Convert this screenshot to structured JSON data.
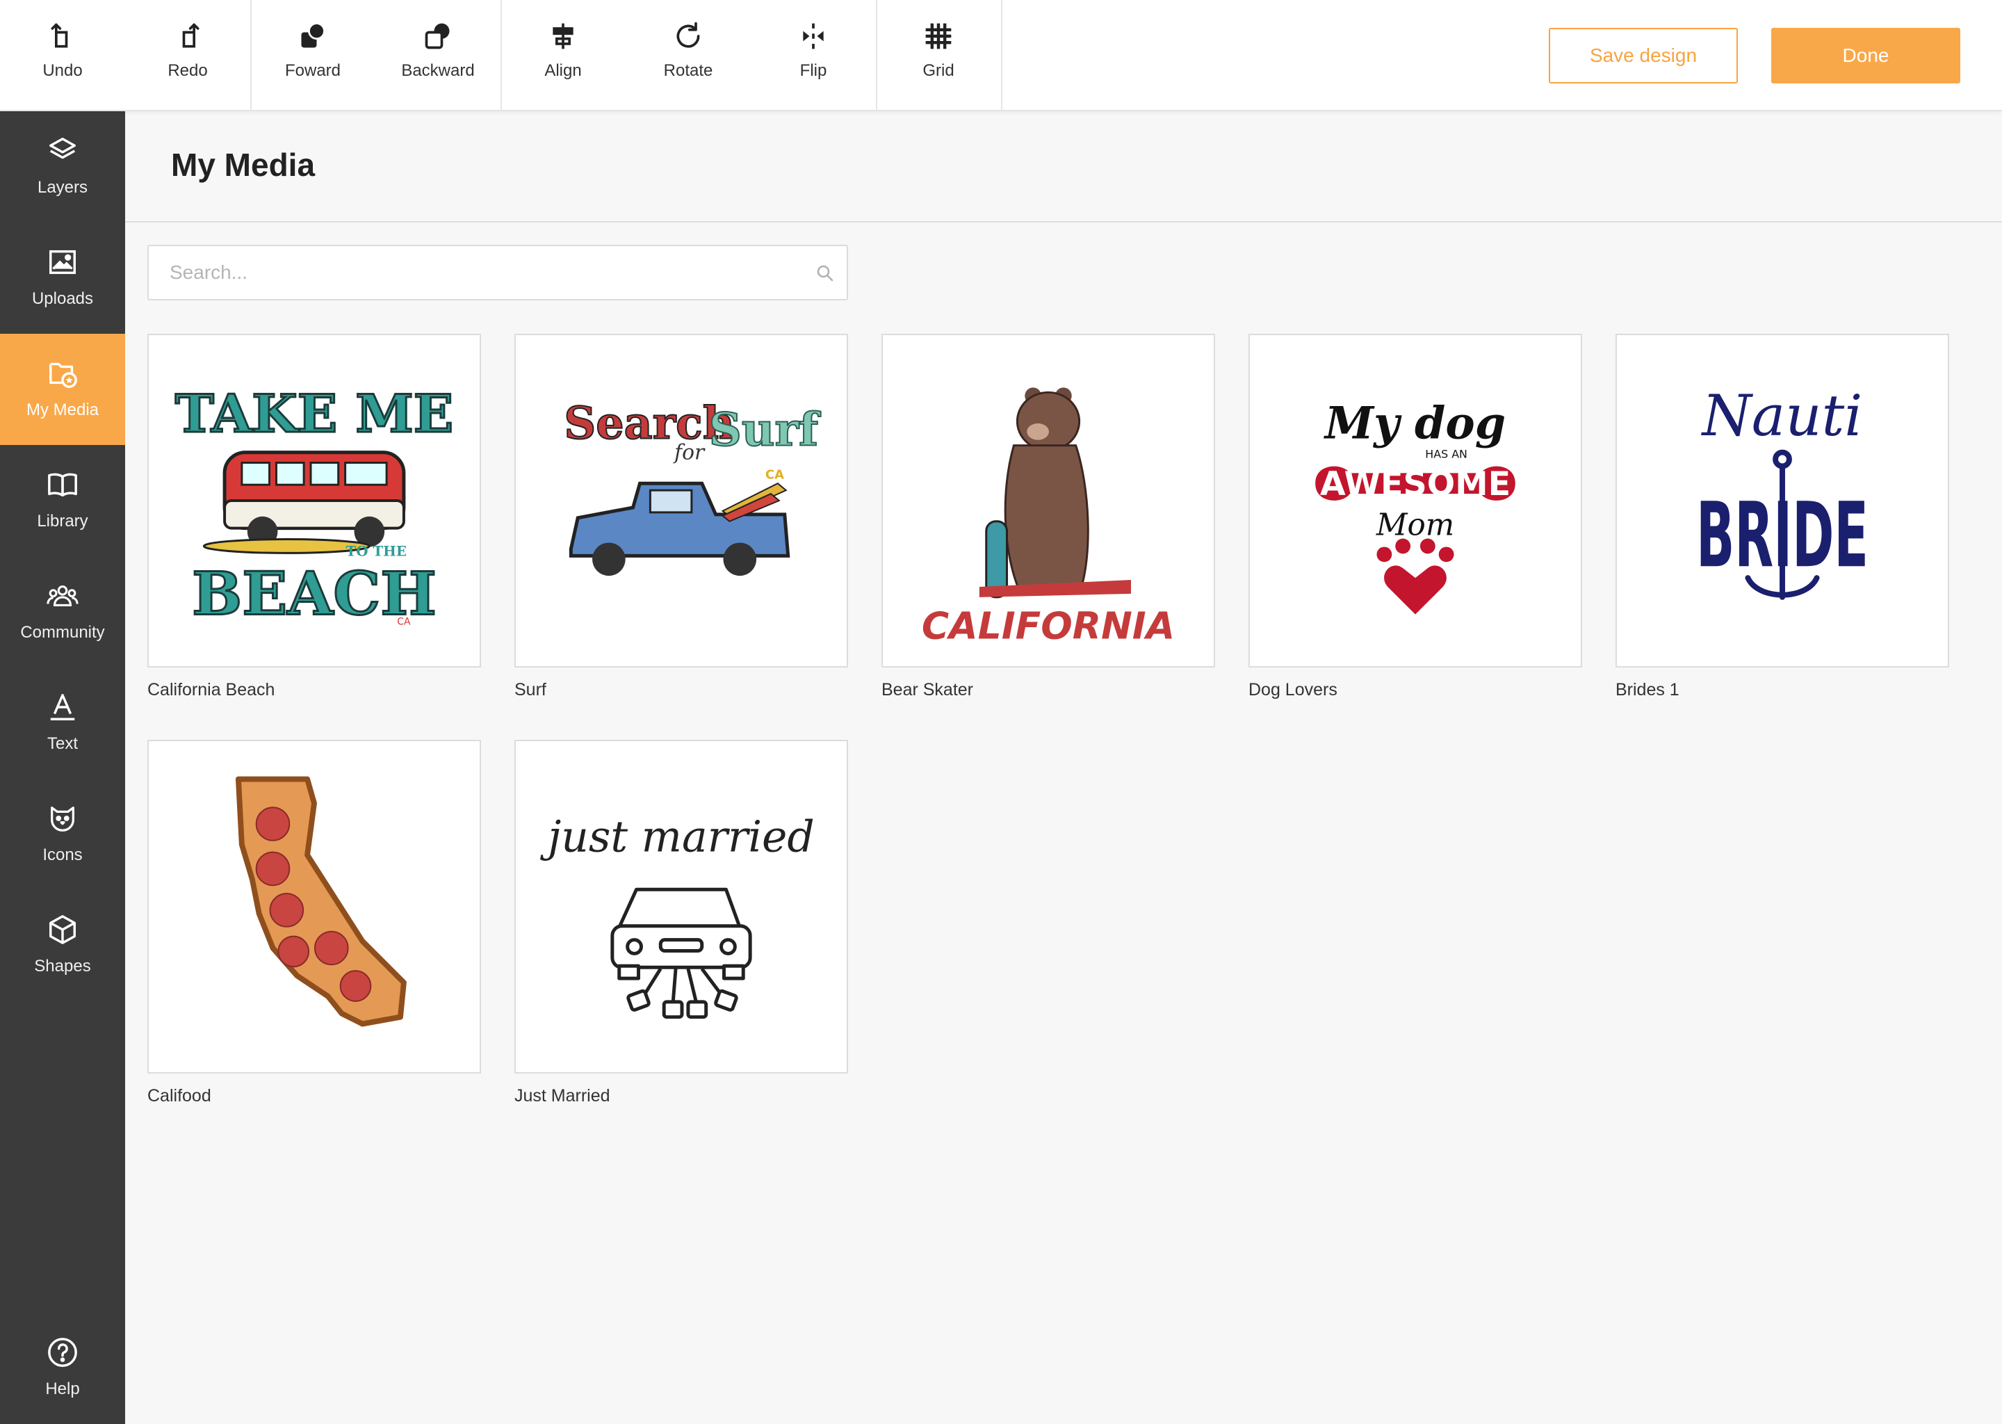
{
  "toolbar": {
    "undo": "Undo",
    "redo": "Redo",
    "forward": "Foward",
    "backward": "Backward",
    "align": "Align",
    "rotate": "Rotate",
    "flip": "Flip",
    "grid": "Grid",
    "save_label": "Save design",
    "done_label": "Done"
  },
  "sidebar": {
    "items": [
      {
        "label": "Layers",
        "icon": "layers-icon"
      },
      {
        "label": "Uploads",
        "icon": "image-icon"
      },
      {
        "label": "My Media",
        "icon": "folder-star-icon",
        "active": true
      },
      {
        "label": "Library",
        "icon": "book-icon"
      },
      {
        "label": "Community",
        "icon": "people-icon"
      },
      {
        "label": "Text",
        "icon": "text-icon"
      },
      {
        "label": "Icons",
        "icon": "cat-face-icon"
      },
      {
        "label": "Shapes",
        "icon": "cube-icon"
      }
    ],
    "help": "Help"
  },
  "main": {
    "title": "My Media",
    "search": {
      "placeholder": "Search...",
      "value": ""
    },
    "media": [
      {
        "name": "California Beach",
        "art_text": [
          "TAKE ME",
          "TO THE",
          "BEACH",
          "CA"
        ]
      },
      {
        "name": "Surf",
        "art_text": [
          "Search",
          "for",
          "Surf",
          "CA"
        ]
      },
      {
        "name": "Bear Skater",
        "art_text": [
          "CALIFORNIA"
        ]
      },
      {
        "name": "Dog Lovers",
        "art_text": [
          "My dog",
          "HAS AN",
          "AWESOME",
          "Mom"
        ]
      },
      {
        "name": "Brides 1",
        "art_text": [
          "Nauti",
          "BRIDE"
        ]
      },
      {
        "name": "Califood",
        "art_text": []
      },
      {
        "name": "Just Married",
        "art_text": [
          "just married"
        ]
      }
    ]
  },
  "colors": {
    "accent": "#f9a849",
    "sidebar_bg": "#3b3b3b",
    "canvas_bg": "#f7f7f7"
  }
}
